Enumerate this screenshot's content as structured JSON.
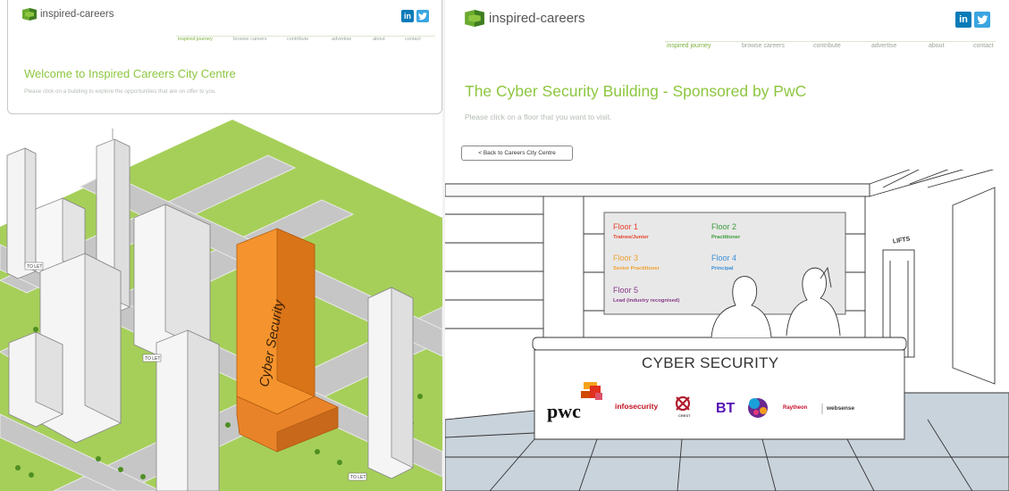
{
  "left": {
    "logo_text": "inspired-careers",
    "social": {
      "linkedin": "in",
      "twitter": "t"
    },
    "nav": [
      "inspired journey",
      "browse careers",
      "contribute",
      "advertise",
      "about",
      "contact"
    ],
    "welcome": "Welcome to Inspired Careers City Centre",
    "subtext": "Please click on a building to explore the opportunities that are on offer to you.",
    "building_label": "Cyber Security",
    "to_let": "TO LET"
  },
  "right": {
    "logo_text": "inspired-careers",
    "social": {
      "linkedin": "in",
      "twitter": "t"
    },
    "nav": [
      "inspired journey",
      "browse careers",
      "contribute",
      "advertise",
      "about",
      "contact"
    ],
    "title": "The Cyber Security Building - Sponsored by PwC",
    "subtext": "Please click on a floor that you want to visit.",
    "back_button": "< Back to Careers City Centre",
    "floors": [
      {
        "name": "Floor 1",
        "level": "Trainee/Junior",
        "color": "#e8412a"
      },
      {
        "name": "Floor 2",
        "level": "Practitioner",
        "color": "#3a9a3a"
      },
      {
        "name": "Floor 3",
        "level": "Senior Practitioner",
        "color": "#f0a030"
      },
      {
        "name": "Floor 4",
        "level": "Principal",
        "color": "#3a8fd6"
      },
      {
        "name": "Floor 5",
        "level": "Lead (industry recognised)",
        "color": "#8a3a8a"
      }
    ],
    "desk_title": "CYBER SECURITY",
    "lifts": "LIFTS",
    "sponsors": {
      "pwc": "pwc",
      "infosecurity": "infosecurity",
      "crest": "CREST",
      "bt": "BT",
      "raytheon": "Raytheon",
      "websense": "websense"
    }
  },
  "colors": {
    "accent_green": "#8dc63f",
    "building_orange": "#f08a24",
    "grass": "#a6cf5a",
    "road": "#c4c4c4"
  }
}
